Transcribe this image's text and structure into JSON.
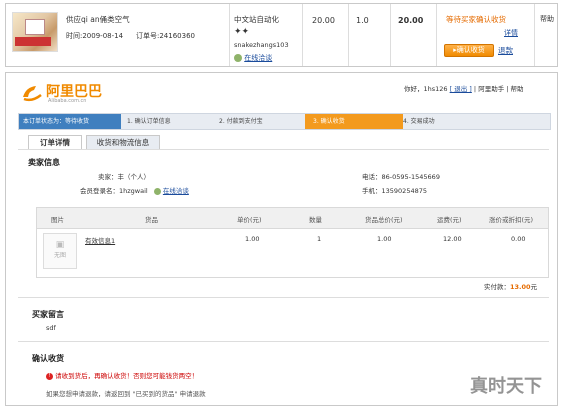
{
  "order": {
    "supplier": "供应qi an俑类空气",
    "time": "时间:2009-08-14",
    "order_no": "订单号:24160360",
    "seller_site": "中文站自动化",
    "seller_id": "snakezhangs103",
    "chat_link": "在线洽谈",
    "price1": "20.00",
    "qty": "1.0",
    "total": "20.00",
    "status": "等待买家确认收货",
    "details_link": "详情",
    "confirm_button": "确认收货",
    "refund_link": "退款",
    "help": "帮助"
  },
  "header": {
    "logo_cn": "阿里巴巴",
    "logo_en": "Alibaba.com.cn",
    "greeting": "你好，",
    "user": "1hs126",
    "logout": "[ 退出 ]",
    "aliwangwang": "阿里助手",
    "help": "帮助"
  },
  "steps": {
    "intro": "本订单状态为：等待收货",
    "items": [
      "1. 确认订单信息",
      "2. 付款到支付宝",
      "3. 确认收货",
      "4. 交易成功"
    ],
    "active_index": 2
  },
  "tabs": [
    "订单详情",
    "收货和物流信息"
  ],
  "seller_info": {
    "title": "卖家信息",
    "seller_label": "卖家：",
    "seller_value": "丰（个人）",
    "member_label": "会员登录名：",
    "member_value": "1hzgwail",
    "chat_link": "在线洽谈",
    "phone_label": "电话：",
    "phone_value": "86-0595-1545669",
    "mobile_label": "手机：",
    "mobile_value": "13590254875"
  },
  "table": {
    "headers": [
      "图片",
      "货品",
      "单价(元)",
      "数量",
      "货品总价(元)",
      "运费(元)",
      "涨价或折扣(元)"
    ],
    "row": {
      "image_placeholder": "无图",
      "name": "有效信息1",
      "unit_price": "1.00",
      "quantity": "1",
      "total": "1.00",
      "shipping": "12.00",
      "adjust": "0.00"
    },
    "paid_label": "实付款：",
    "paid_value": "13.00",
    "paid_unit": "元"
  },
  "buyer_message": {
    "title": "买家留言",
    "text": "sdf"
  },
  "confirm": {
    "title": "确认收货",
    "warning": "请收到货后，再确认收货！否则您可能钱货两空！",
    "note": "如果您想申请退款，请返回到 \"已买到的货品\" 申请退款"
  },
  "watermark": "真时天下",
  "colors": {
    "orange": "#f08a00",
    "step_active": "#f39a1e",
    "link": "#1a4b9b",
    "price_red": "#e56b00"
  }
}
